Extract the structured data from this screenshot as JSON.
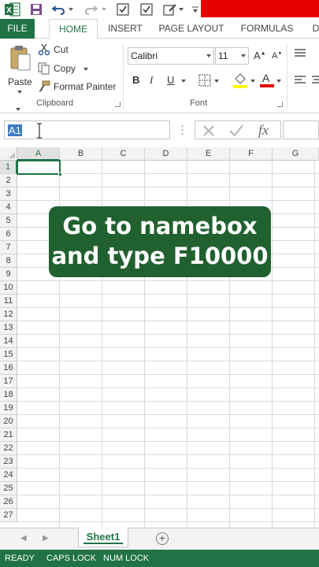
{
  "colors": {
    "excel_green": "#217346",
    "caption_bg": "#21612f",
    "redaction": "#e60000",
    "selection_blue": "#3d7ac4"
  },
  "qat": {
    "icons": [
      "excel-logo-icon",
      "save-icon",
      "undo-icon",
      "redo-icon",
      "checkbox-icon",
      "checkbox-icon",
      "form-edit-icon",
      "customize-qat-icon"
    ],
    "excel_logo_letter": "X"
  },
  "tabs": [
    "FILE",
    "HOME",
    "INSERT",
    "PAGE LAYOUT",
    "FORMULAS",
    "D"
  ],
  "ribbon": {
    "clipboard": {
      "paste": "Paste",
      "cut": "Cut",
      "copy": "Copy",
      "format_painter": "Format Painter",
      "label": "Clipboard"
    },
    "font": {
      "name": "Calibri",
      "size": "11",
      "grow": "A",
      "shrink": "A",
      "bold": "B",
      "italic": "I",
      "underline": "U",
      "font_color_letter": "A",
      "label": "Font"
    }
  },
  "formula_bar": {
    "name_box": "A1",
    "fx": "fx",
    "formula": ""
  },
  "grid": {
    "columns": [
      "A",
      "B",
      "C",
      "D",
      "E",
      "F",
      "G"
    ],
    "rows": [
      "1",
      "2",
      "3",
      "4",
      "5",
      "6",
      "7",
      "8",
      "9",
      "10",
      "11",
      "12",
      "13",
      "14",
      "15",
      "16",
      "17",
      "18",
      "19",
      "20",
      "21",
      "22",
      "23",
      "24",
      "25",
      "26",
      "27"
    ],
    "active_cell": "A1"
  },
  "caption": {
    "line1": "Go to namebox",
    "line2": "and type F10000"
  },
  "sheets": {
    "tabs": [
      "Sheet1"
    ],
    "add": "+"
  },
  "status": {
    "ready": "READY",
    "caps": "CAPS LOCK",
    "num": "NUM LOCK"
  }
}
